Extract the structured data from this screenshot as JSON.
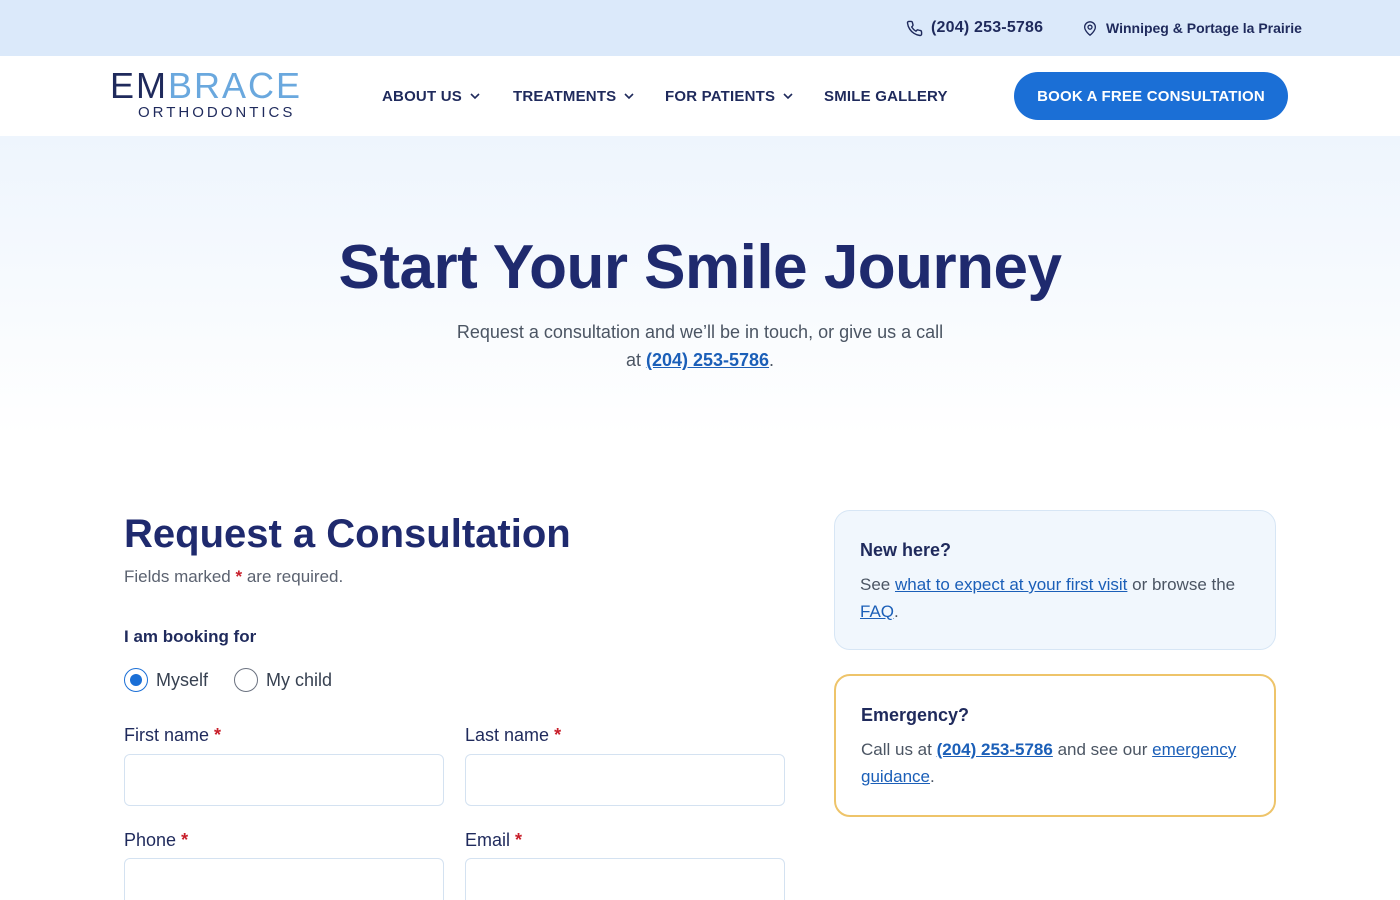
{
  "topbar": {
    "phone": "(204) 253-5786",
    "location": "Winnipeg & Portage la Prairie"
  },
  "logo": {
    "line1_dark": "EM",
    "line1_light": "BRACE",
    "line2": "ORTHODONTICS"
  },
  "nav": {
    "items": [
      {
        "label": "ABOUT US",
        "has_dropdown": true
      },
      {
        "label": "TREATMENTS",
        "has_dropdown": true
      },
      {
        "label": "FOR PATIENTS",
        "has_dropdown": true
      },
      {
        "label": "SMILE GALLERY",
        "has_dropdown": false
      }
    ],
    "cta": "BOOK A FREE CONSULTATION"
  },
  "hero": {
    "title": "Start Your Smile Journey",
    "subtitle_before": "Request a consultation and we’ll be in touch, or give us a call at ",
    "subtitle_link": "(204) 253-5786",
    "subtitle_after": "."
  },
  "form": {
    "title": "Request a Consultation",
    "required_note_before": "Fields marked ",
    "required_star": "*",
    "required_note_after": " are required.",
    "booking_label": "I am booking for",
    "booking_options": [
      {
        "label": "Myself",
        "selected": true
      },
      {
        "label": "My child",
        "selected": false
      }
    ],
    "fields": {
      "first_name": {
        "label": "First name",
        "value": "",
        "required": true
      },
      "last_name": {
        "label": "Last name",
        "value": "",
        "required": true
      },
      "phone": {
        "label": "Phone",
        "value": "",
        "required": true
      },
      "email": {
        "label": "Email",
        "value": "",
        "required": true
      }
    }
  },
  "cards": {
    "new_here": {
      "title": "New here?",
      "text_before": "See ",
      "link1": "what to expect at your first visit",
      "text_middle": " or browse the ",
      "link2": "FAQ",
      "text_after": "."
    },
    "emergency": {
      "title": "Emergency?",
      "text_before": "Call us at ",
      "link1": "(204) 253-5786",
      "text_middle": " and see our ",
      "link2": "emergency guidance",
      "text_after": "."
    }
  },
  "colors": {
    "brand_navy": "#1f2a6e",
    "brand_blue": "#1b6fd6",
    "topbar_bg": "#dbe9fa",
    "emergency_border": "#eec46a",
    "required_red": "#c81e2a"
  }
}
